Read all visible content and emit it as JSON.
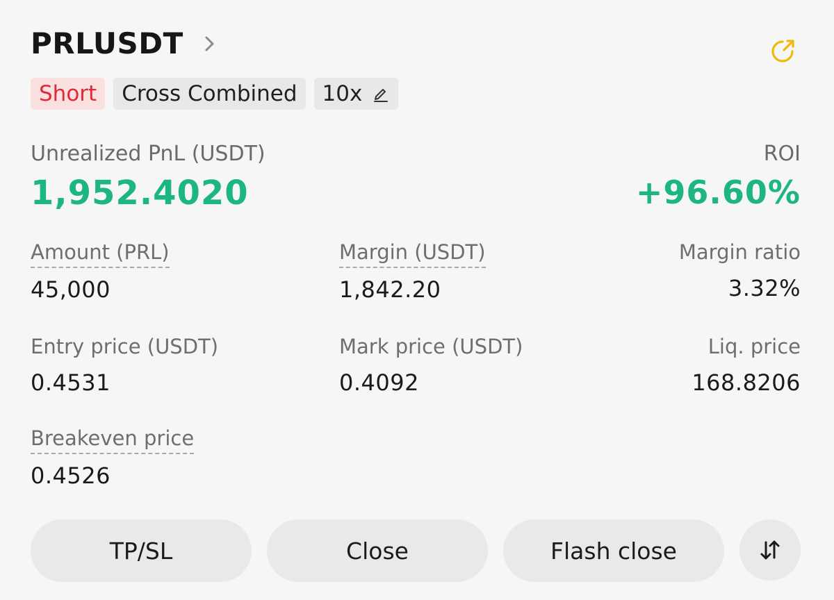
{
  "position": {
    "symbol": "PRLUSDT",
    "side": "Short",
    "margin_mode": "Cross Combined",
    "leverage": "10x"
  },
  "pnl": {
    "label": "Unrealized PnL (USDT)",
    "value": "1,952.4020",
    "roi_label": "ROI",
    "roi_value": "+96.60%"
  },
  "stats": {
    "amount_label": "Amount (PRL)",
    "amount_value": "45,000",
    "margin_label": "Margin (USDT)",
    "margin_value": "1,842.20",
    "margin_ratio_label": "Margin ratio",
    "margin_ratio_value": "3.32%",
    "entry_label": "Entry price (USDT)",
    "entry_value": "0.4531",
    "mark_label": "Mark price (USDT)",
    "mark_value": "0.4092",
    "liq_label": "Liq. price",
    "liq_value": "168.8206",
    "breakeven_label": "Breakeven price",
    "breakeven_value": "0.4526"
  },
  "actions": {
    "tpsl_label": "TP/SL",
    "close_label": "Close",
    "flash_close_label": "Flash close"
  },
  "icons": {
    "chevron": "chevron-right-icon",
    "share": "share-icon",
    "edit": "pencil-icon",
    "reverse": "swap-vertical-icon"
  },
  "colors": {
    "profit": "#1db584",
    "short_text": "#e02a3a",
    "short_bg": "#fbe0e0",
    "accent": "#f0b90b"
  }
}
